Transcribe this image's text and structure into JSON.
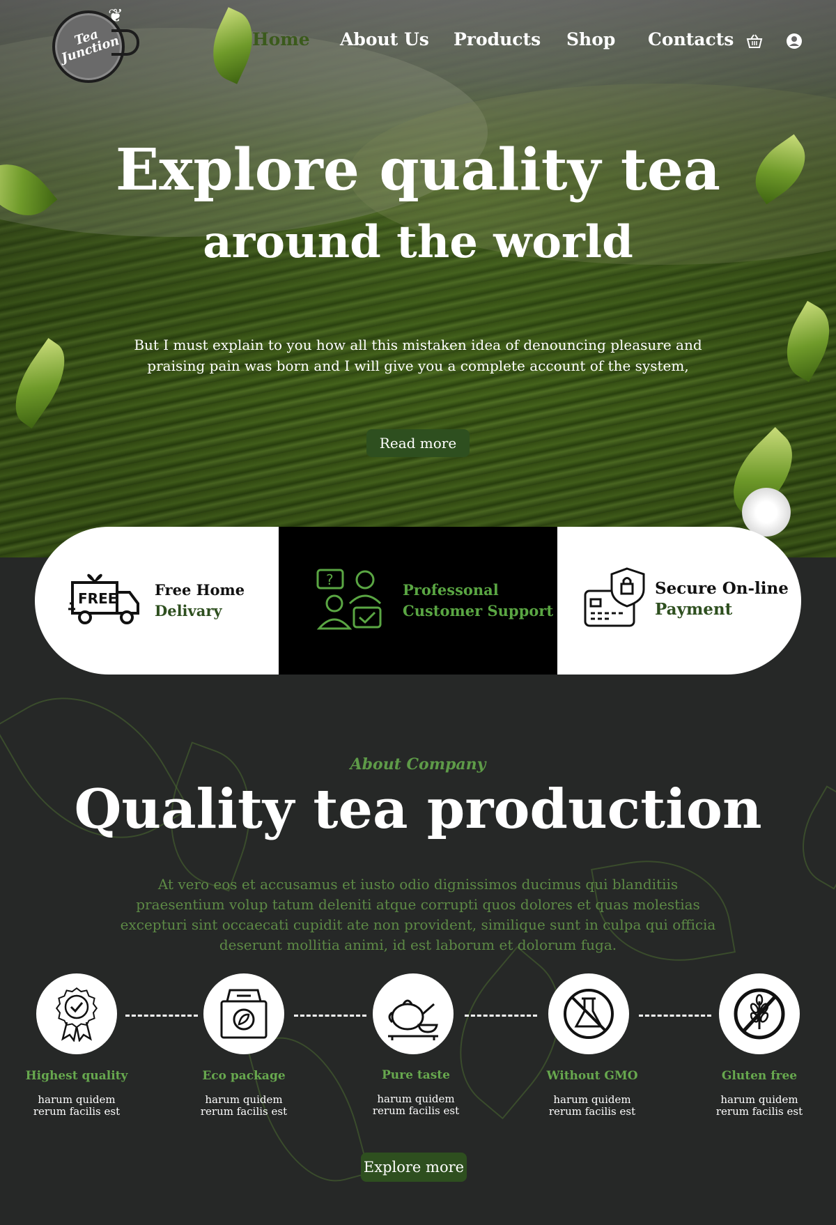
{
  "nav": {
    "logo_line1": "Tea",
    "logo_line2": "Junction",
    "items": [
      {
        "label": "Home",
        "active": true
      },
      {
        "label": "About Us"
      },
      {
        "label": "Products"
      },
      {
        "label": "Shop"
      },
      {
        "label": "Contacts"
      }
    ],
    "icons": [
      "basket-icon",
      "user-icon"
    ]
  },
  "hero": {
    "title_line1": "Explore quality tea",
    "title_line2": "around the world",
    "text": "But I must explain to you how all this mistaken idea of denouncing pleasure and praising pain was born and I will give you a complete account of the system,",
    "button": "Read more"
  },
  "features": [
    {
      "line1": "Free Home",
      "line2": "Delivary",
      "icon": "free-delivery-truck-icon",
      "badge": "FREE"
    },
    {
      "line1": "Professonal",
      "line2": "Customer Support",
      "icon": "customer-support-icon"
    },
    {
      "line1": "Secure On-line",
      "line2": "Payment",
      "icon": "secure-payment-icon"
    }
  ],
  "about": {
    "subtitle": "About Company",
    "title": "Quality tea production",
    "text": "At vero eos et accusamus et iusto odio dignissimos ducimus qui blanditiis praesentium volup tatum deleniti atque corrupti quos dolores et quas molestias excepturi sint occaecati cupidit ate non provident, similique sunt in culpa qui officia deserunt mollitia animi, id est laborum et dolorum fuga.",
    "steps": [
      {
        "title": "Highest quality",
        "desc1": "harum quidem",
        "desc2": "rerum facilis est",
        "icon": "quality-badge-icon"
      },
      {
        "title": "Eco package",
        "desc1": "harum quidem",
        "desc2": "rerum facilis est",
        "icon": "eco-package-icon"
      },
      {
        "title": "Pure taste",
        "desc1": "harum quidem",
        "desc2": "rerum facilis est",
        "icon": "teapot-icon"
      },
      {
        "title": "Without GMO",
        "desc1": "harum quidem",
        "desc2": "rerum facilis est",
        "icon": "no-gmo-icon"
      },
      {
        "title": "Gluten free",
        "desc1": "harum quidem",
        "desc2": "rerum facilis est",
        "icon": "gluten-free-icon"
      }
    ],
    "button": "Explore more"
  },
  "colors": {
    "accent_green": "#2e4f1f",
    "text_green": "#5e9b48",
    "dark_bg": "#262827"
  }
}
